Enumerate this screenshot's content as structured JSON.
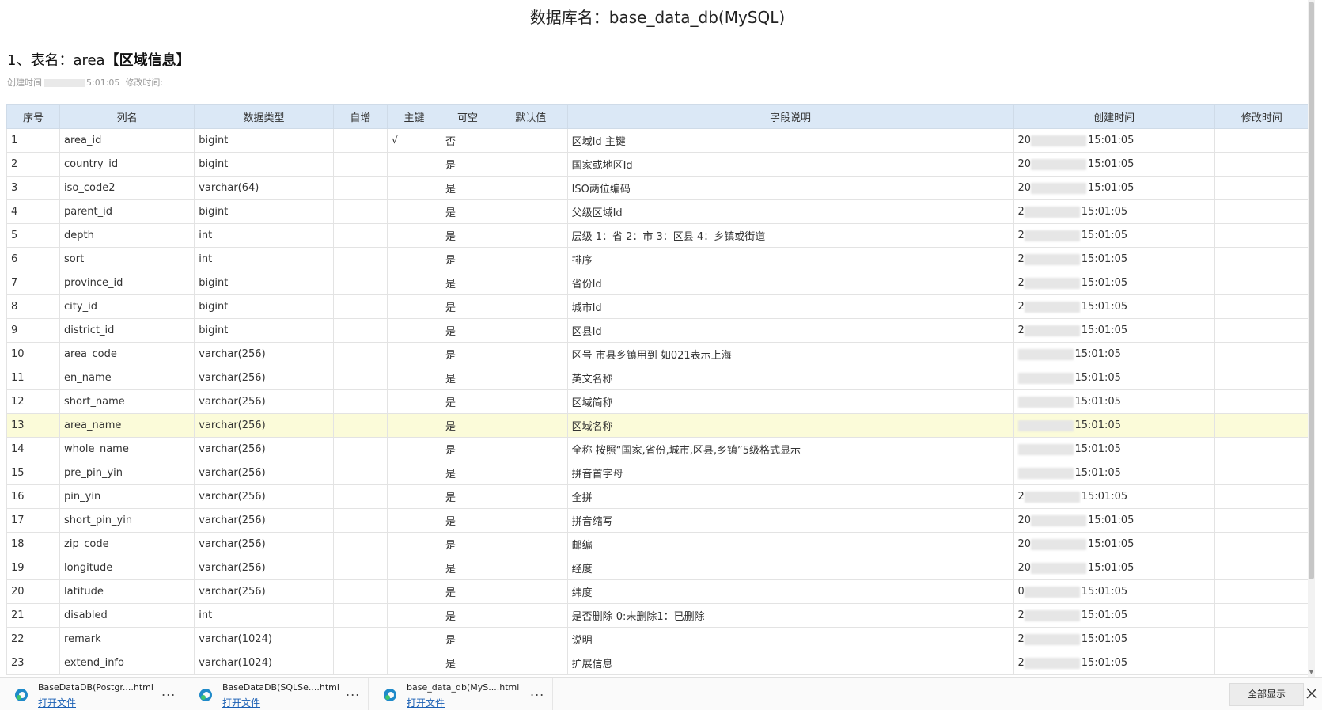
{
  "db_title": "数据库名：base_data_db(MySQL)",
  "table_title": {
    "prefix": "1、表名：area",
    "bold": "【区域信息】"
  },
  "meta": {
    "created_label": "创建时间",
    "created_tail": "5:01:05",
    "modified_label": "修改时间:"
  },
  "table": {
    "headers": [
      "序号",
      "列名",
      "数据类型",
      "自增",
      "主键",
      "可空",
      "默认值",
      "字段说明",
      "创建时间",
      "修改时间"
    ],
    "time_tail": "15:01:05",
    "rows": [
      {
        "no": "1",
        "name": "area_id",
        "type": "bigint",
        "auto": "",
        "pk": "√",
        "nullable": "否",
        "default": "",
        "desc": "区域Id 主键",
        "created_head": "20"
      },
      {
        "no": "2",
        "name": "country_id",
        "type": "bigint",
        "auto": "",
        "pk": "",
        "nullable": "是",
        "default": "",
        "desc": "国家或地区Id",
        "created_head": "20"
      },
      {
        "no": "3",
        "name": "iso_code2",
        "type": "varchar(64)",
        "auto": "",
        "pk": "",
        "nullable": "是",
        "default": "",
        "desc": "ISO两位编码",
        "created_head": "20"
      },
      {
        "no": "4",
        "name": "parent_id",
        "type": "bigint",
        "auto": "",
        "pk": "",
        "nullable": "是",
        "default": "",
        "desc": "父级区域Id",
        "created_head": "2"
      },
      {
        "no": "5",
        "name": "depth",
        "type": "int",
        "auto": "",
        "pk": "",
        "nullable": "是",
        "default": "",
        "desc": "层级 1：省 2：市 3：区县 4：乡镇或街道",
        "created_head": "2"
      },
      {
        "no": "6",
        "name": "sort",
        "type": "int",
        "auto": "",
        "pk": "",
        "nullable": "是",
        "default": "",
        "desc": "排序",
        "created_head": "2"
      },
      {
        "no": "7",
        "name": "province_id",
        "type": "bigint",
        "auto": "",
        "pk": "",
        "nullable": "是",
        "default": "",
        "desc": "省份Id",
        "created_head": "2"
      },
      {
        "no": "8",
        "name": "city_id",
        "type": "bigint",
        "auto": "",
        "pk": "",
        "nullable": "是",
        "default": "",
        "desc": "城市Id",
        "created_head": "2"
      },
      {
        "no": "9",
        "name": "district_id",
        "type": "bigint",
        "auto": "",
        "pk": "",
        "nullable": "是",
        "default": "",
        "desc": "区县Id",
        "created_head": "2"
      },
      {
        "no": "10",
        "name": "area_code",
        "type": "varchar(256)",
        "auto": "",
        "pk": "",
        "nullable": "是",
        "default": "",
        "desc": "区号 市县乡镇用到 如021表示上海",
        "created_head": ""
      },
      {
        "no": "11",
        "name": "en_name",
        "type": "varchar(256)",
        "auto": "",
        "pk": "",
        "nullable": "是",
        "default": "",
        "desc": "英文名称",
        "created_head": ""
      },
      {
        "no": "12",
        "name": "short_name",
        "type": "varchar(256)",
        "auto": "",
        "pk": "",
        "nullable": "是",
        "default": "",
        "desc": "区域简称",
        "created_head": ""
      },
      {
        "no": "13",
        "name": "area_name",
        "type": "varchar(256)",
        "auto": "",
        "pk": "",
        "nullable": "是",
        "default": "",
        "desc": "区域名称",
        "created_head": ""
      },
      {
        "no": "14",
        "name": "whole_name",
        "type": "varchar(256)",
        "auto": "",
        "pk": "",
        "nullable": "是",
        "default": "",
        "desc": "全称 按照“国家,省份,城市,区县,乡镇”5级格式显示",
        "created_head": ""
      },
      {
        "no": "15",
        "name": "pre_pin_yin",
        "type": "varchar(256)",
        "auto": "",
        "pk": "",
        "nullable": "是",
        "default": "",
        "desc": "拼音首字母",
        "created_head": ""
      },
      {
        "no": "16",
        "name": "pin_yin",
        "type": "varchar(256)",
        "auto": "",
        "pk": "",
        "nullable": "是",
        "default": "",
        "desc": "全拼",
        "created_head": "2"
      },
      {
        "no": "17",
        "name": "short_pin_yin",
        "type": "varchar(256)",
        "auto": "",
        "pk": "",
        "nullable": "是",
        "default": "",
        "desc": "拼音缩写",
        "created_head": "20"
      },
      {
        "no": "18",
        "name": "zip_code",
        "type": "varchar(256)",
        "auto": "",
        "pk": "",
        "nullable": "是",
        "default": "",
        "desc": "邮编",
        "created_head": "20"
      },
      {
        "no": "19",
        "name": "longitude",
        "type": "varchar(256)",
        "auto": "",
        "pk": "",
        "nullable": "是",
        "default": "",
        "desc": "经度",
        "created_head": "20"
      },
      {
        "no": "20",
        "name": "latitude",
        "type": "varchar(256)",
        "auto": "",
        "pk": "",
        "nullable": "是",
        "default": "",
        "desc": "纬度",
        "created_head": "0"
      },
      {
        "no": "21",
        "name": "disabled",
        "type": "int",
        "auto": "",
        "pk": "",
        "nullable": "是",
        "default": "",
        "desc": "是否删除 0:未删除1：已删除",
        "created_head": "2"
      },
      {
        "no": "22",
        "name": "remark",
        "type": "varchar(1024)",
        "auto": "",
        "pk": "",
        "nullable": "是",
        "default": "",
        "desc": "说明",
        "created_head": "2"
      },
      {
        "no": "23",
        "name": "extend_info",
        "type": "varchar(1024)",
        "auto": "",
        "pk": "",
        "nullable": "是",
        "default": "",
        "desc": "扩展信息",
        "created_head": "2"
      }
    ]
  },
  "download_bar": {
    "items": [
      {
        "name": "BaseDataDB(Postgr....html",
        "link": "打开文件",
        "more": "..."
      },
      {
        "name": "BaseDataDB(SQLSe....html",
        "link": "打开文件",
        "more": "..."
      },
      {
        "name": "base_data_db(MyS....html",
        "link": "打开文件",
        "more": "..."
      }
    ],
    "show_all": "全部显示"
  },
  "colors": {
    "header_bg": "#dbe8f6",
    "highlight_row": "#fbfbd9",
    "edge_icon": "#1f8ac9"
  },
  "icons": {
    "browser_file": "edge-icon",
    "close": "close-icon"
  }
}
